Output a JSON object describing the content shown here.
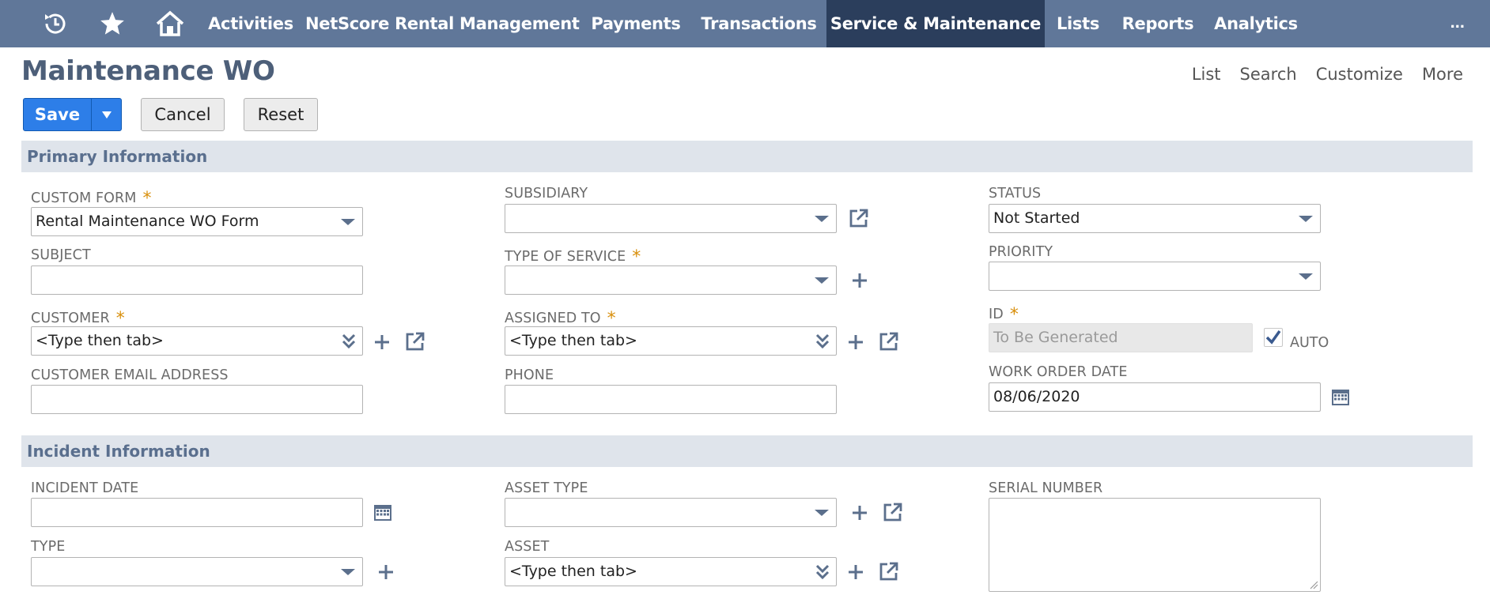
{
  "nav": {
    "icons": [
      "recent-icon",
      "star-icon",
      "home-icon"
    ],
    "items": [
      "Activities",
      "NetScore Rental Management",
      "Payments",
      "Transactions",
      "Service & Maintenance",
      "Lists",
      "Reports",
      "Analytics"
    ],
    "more": "..."
  },
  "page": {
    "title": "Maintenance WO",
    "links": [
      "List",
      "Search",
      "Customize",
      "More"
    ]
  },
  "actions": {
    "save": "Save",
    "cancel": "Cancel",
    "reset": "Reset"
  },
  "sections": {
    "primary": "Primary Information",
    "incident": "Incident Information"
  },
  "fields": {
    "custom_form": {
      "label": "CUSTOM FORM",
      "value": "Rental Maintenance WO Form"
    },
    "subject": {
      "label": "SUBJECT",
      "value": ""
    },
    "customer": {
      "label": "CUSTOMER",
      "value": "<Type then tab>"
    },
    "customer_email": {
      "label": "CUSTOMER EMAIL ADDRESS",
      "value": ""
    },
    "subsidiary": {
      "label": "SUBSIDIARY",
      "value": ""
    },
    "type_of_service": {
      "label": "TYPE OF SERVICE",
      "value": ""
    },
    "assigned_to": {
      "label": "ASSIGNED TO",
      "value": "<Type then tab>"
    },
    "phone": {
      "label": "PHONE",
      "value": ""
    },
    "status": {
      "label": "STATUS",
      "value": "Not Started"
    },
    "priority": {
      "label": "PRIORITY",
      "value": ""
    },
    "id": {
      "label": "ID",
      "value": "To Be Generated",
      "auto_label": "AUTO",
      "auto_checked": true
    },
    "work_order_date": {
      "label": "WORK ORDER DATE",
      "value": "08/06/2020"
    },
    "incident_date": {
      "label": "INCIDENT DATE",
      "value": ""
    },
    "type": {
      "label": "TYPE",
      "value": ""
    },
    "asset_type": {
      "label": "ASSET TYPE",
      "value": ""
    },
    "asset": {
      "label": "ASSET",
      "value": "<Type then tab>"
    },
    "serial_number": {
      "label": "SERIAL NUMBER",
      "value": ""
    }
  },
  "colors": {
    "nav_bg": "#607799",
    "nav_active": "#2b3e5c",
    "primary_button": "#2d7ee8",
    "section_bg": "#dfe4eb",
    "required": "#d88f0c"
  }
}
